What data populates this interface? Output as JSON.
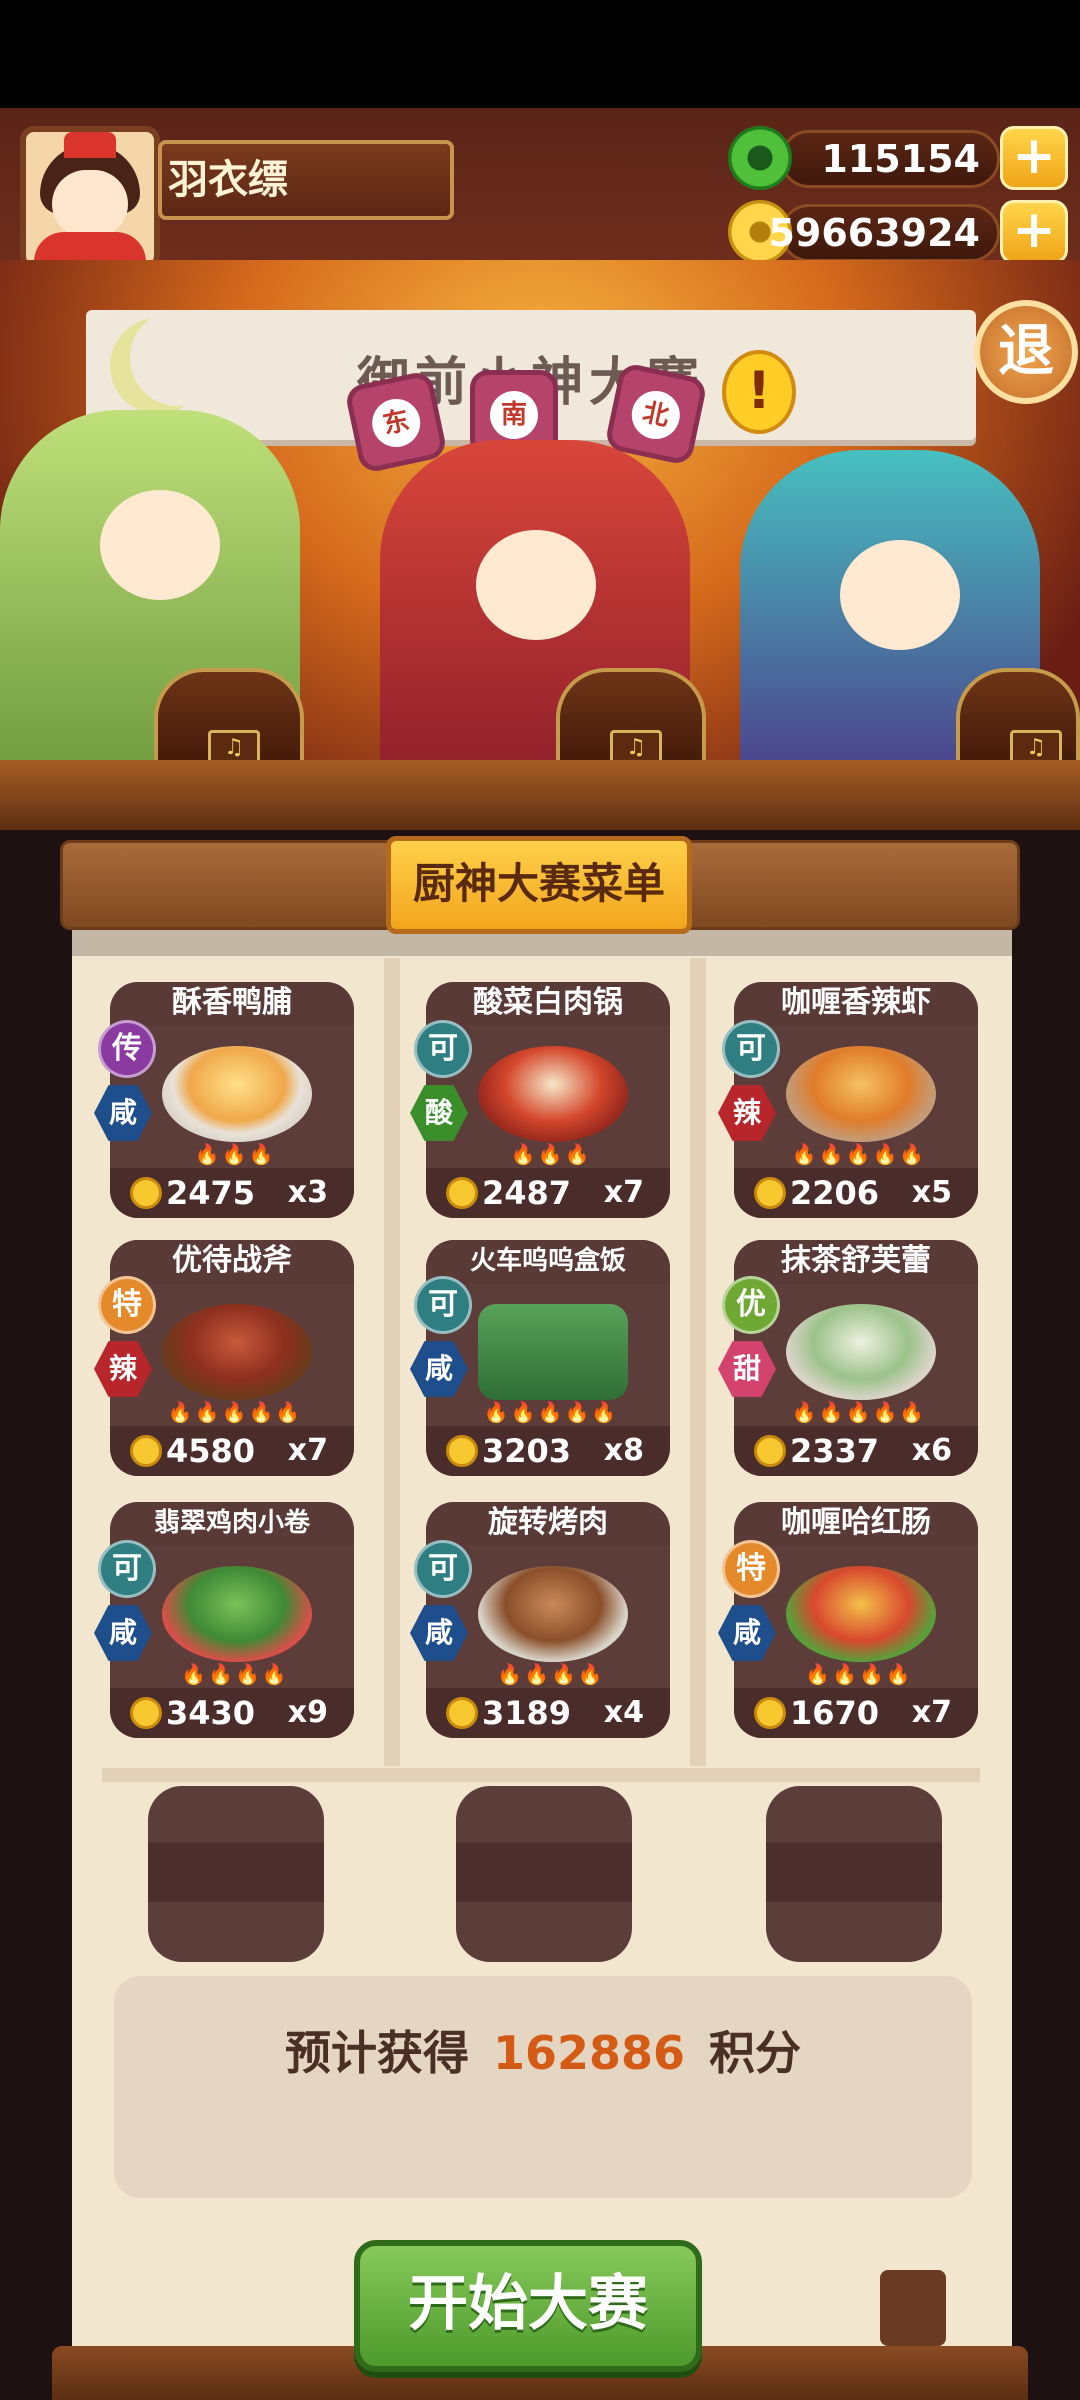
{
  "player": {
    "name": "羽衣缥"
  },
  "currency": {
    "jade": {
      "value": "115154",
      "icon": "jade-coin-icon"
    },
    "coins": {
      "value": "59663924",
      "icon": "copper-coin-icon"
    },
    "plus_label": "+"
  },
  "stage": {
    "banner_text": "御前小神大赛",
    "alert_label": "!",
    "exit_label": "退",
    "dice": [
      "东",
      "南",
      "北"
    ],
    "box_note": "♫"
  },
  "menu": {
    "title": "厨神大赛菜单",
    "dishes": [
      {
        "name": "酥香鸭脯",
        "rank": "传",
        "flavor": "咸",
        "price": "2475",
        "count": "x3",
        "flames": "🔥🔥🔥"
      },
      {
        "name": "酸菜白肉锅",
        "rank": "可",
        "flavor": "酸",
        "price": "2487",
        "count": "x7",
        "flames": "🔥🔥🔥"
      },
      {
        "name": "咖喱香辣虾",
        "rank": "可",
        "flavor": "辣",
        "price": "2206",
        "count": "x5",
        "flames": "🔥🔥🔥🔥🔥"
      },
      {
        "name": "优待战斧",
        "rank": "特",
        "flavor": "辣",
        "price": "4580",
        "count": "x7",
        "flames": "🔥🔥🔥🔥🔥"
      },
      {
        "name": "火车呜呜盒饭",
        "rank": "可",
        "flavor": "咸",
        "price": "3203",
        "count": "x8",
        "flames": "🔥🔥🔥🔥🔥"
      },
      {
        "name": "抹茶舒芙蕾",
        "rank": "优",
        "flavor": "甜",
        "price": "2337",
        "count": "x6",
        "flames": "🔥🔥🔥🔥🔥"
      },
      {
        "name": "翡翠鸡肉小卷",
        "rank": "可",
        "flavor": "咸",
        "price": "3430",
        "count": "x9",
        "flames": "🔥🔥🔥🔥"
      },
      {
        "name": "旋转烤肉",
        "rank": "可",
        "flavor": "咸",
        "price": "3189",
        "count": "x4",
        "flames": "🔥🔥🔥🔥"
      },
      {
        "name": "咖喱哈红肠",
        "rank": "特",
        "flavor": "咸",
        "price": "1670",
        "count": "x7",
        "flames": "🔥🔥🔥🔥"
      }
    ]
  },
  "score": {
    "prefix": "预计获得",
    "value": "162886",
    "suffix": "积分"
  },
  "start_button": {
    "label": "开始大赛"
  },
  "colors": {
    "rank_传": "#8a3aa0",
    "rank_可": "#2f7f82",
    "rank_特": "#e58a2a",
    "rank_优": "#6fa832",
    "flavor_咸": "#1f4e8c",
    "flavor_酸": "#3a8f2a",
    "flavor_辣": "#b8262b",
    "flavor_甜": "#d4436e"
  }
}
